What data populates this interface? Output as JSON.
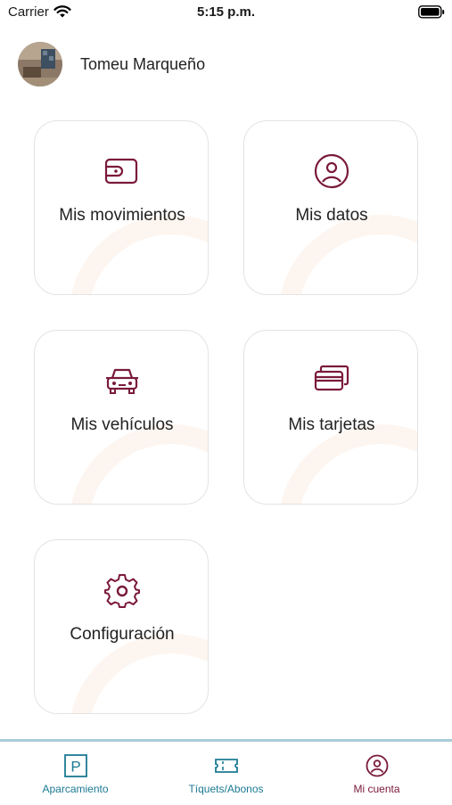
{
  "status_bar": {
    "carrier": "Carrier",
    "time": "5:15 p.m."
  },
  "profile": {
    "name": "Tomeu Marqueño"
  },
  "menu": [
    {
      "label": "Mis movimientos",
      "icon": "wallet-icon"
    },
    {
      "label": "Mis datos",
      "icon": "user-circle-icon"
    },
    {
      "label": "Mis vehículos",
      "icon": "car-icon"
    },
    {
      "label": "Mis tarjetas",
      "icon": "cards-icon"
    },
    {
      "label": "Configuración",
      "icon": "gear-icon"
    }
  ],
  "tabs": [
    {
      "label": "Aparcamiento",
      "icon": "parking-icon",
      "active": false
    },
    {
      "label": "Tíquets/Abonos",
      "icon": "ticket-icon",
      "active": false
    },
    {
      "label": "Mi cuenta",
      "icon": "user-circle-icon",
      "active": true
    }
  ],
  "colors": {
    "accent": "#7a1a3a",
    "teal": "#1c7a93",
    "tab_border": "#a9ccd8"
  }
}
